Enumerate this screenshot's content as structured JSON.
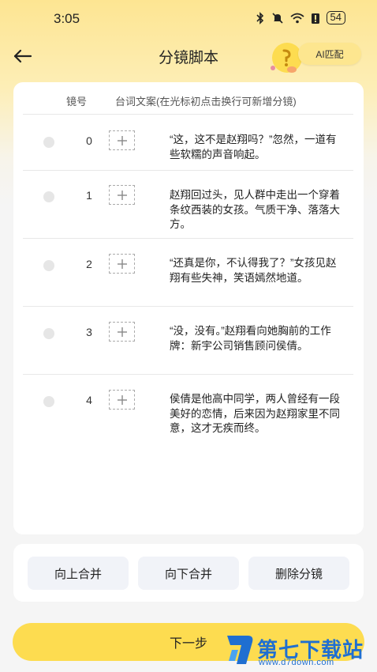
{
  "status_bar": {
    "time": "3:05",
    "icons": [
      "bluetooth-icon",
      "mute-icon",
      "wifi-icon",
      "alert-icon"
    ],
    "battery": "54"
  },
  "header": {
    "title": "分镜脚本",
    "ai_button": "AI匹配"
  },
  "table": {
    "col_number": "镜号",
    "col_text": "台词文案(在光标初点击换行可新增分镜)",
    "rows": [
      {
        "number": "0",
        "text": "“这，这不是赵翔吗？”忽然，一道有些软糯的声音响起。"
      },
      {
        "number": "1",
        "text": "赵翔回过头，见人群中走出一个穿着条纹西装的女孩。气质干净、落落大方。"
      },
      {
        "number": "2",
        "text": "“还真是你，不认得我了？”女孩见赵翔有些失神，笑语嫣然地道。"
      },
      {
        "number": "3",
        "text": "“没，没有。”赵翔看向她胸前的工作牌：新宇公司销售顾问侯倩。"
      },
      {
        "number": "4",
        "text": "侯倩是他高中同学，两人曾经有一段美好的恋情，后来因为赵翔家里不同意，这才无疾而终。"
      }
    ]
  },
  "actions": {
    "merge_up": "向上合并",
    "merge_down": "向下合并",
    "delete": "删除分镜"
  },
  "footer": {
    "next": "下一步"
  },
  "watermark": {
    "name": "第七下载站",
    "url": "www.d7down.com"
  },
  "colors": {
    "accent_yellow": "#fddc50",
    "watermark_blue": "#1f6fd1"
  }
}
